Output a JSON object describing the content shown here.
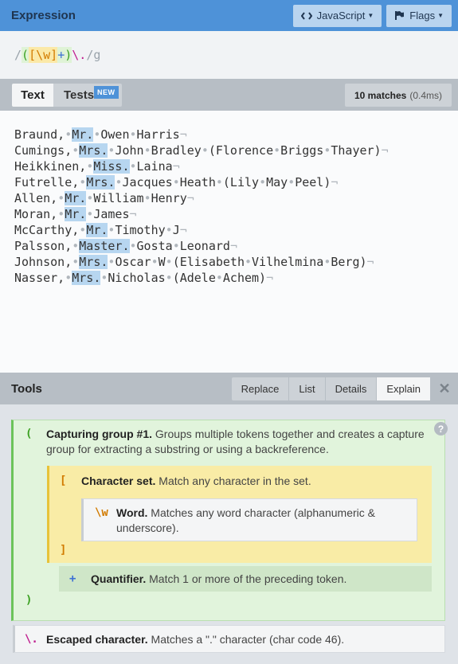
{
  "header": {
    "title": "Expression",
    "flavor_button": "JavaScript",
    "flags_button": "Flags"
  },
  "expression": {
    "open_slash": "/",
    "open_paren": "(",
    "open_bracket": "[",
    "word_token": "\\w",
    "close_bracket": "]",
    "plus": "+",
    "close_paren": ")",
    "escaped_dot": "\\.",
    "close_slash": "/",
    "flags": "g"
  },
  "text_panel": {
    "tab_text": "Text",
    "tab_tests": "Tests",
    "new_badge": "NEW",
    "match_count": "10 matches",
    "match_time": "(0.4ms)",
    "lines": [
      [
        "Braund,",
        " ",
        "Mr.",
        " ",
        "Owen",
        " ",
        "Harris"
      ],
      [
        "Cumings,",
        " ",
        "Mrs.",
        " ",
        "John",
        " ",
        "Bradley",
        " ",
        "(Florence",
        " ",
        "Briggs",
        " ",
        "Thayer)"
      ],
      [
        "Heikkinen,",
        " ",
        "Miss.",
        " ",
        "Laina"
      ],
      [
        "Futrelle,",
        " ",
        "Mrs.",
        " ",
        "Jacques",
        " ",
        "Heath",
        " ",
        "(Lily",
        " ",
        "May",
        " ",
        "Peel)"
      ],
      [
        "Allen,",
        " ",
        "Mr.",
        " ",
        "William",
        " ",
        "Henry"
      ],
      [
        "Moran,",
        " ",
        "Mr.",
        " ",
        "James"
      ],
      [
        "McCarthy,",
        " ",
        "Mr.",
        " ",
        "Timothy",
        " ",
        "J"
      ],
      [
        "Palsson,",
        " ",
        "Master.",
        " ",
        "Gosta",
        " ",
        "Leonard"
      ],
      [
        "Johnson,",
        " ",
        "Mrs.",
        " ",
        "Oscar",
        " ",
        "W",
        " ",
        "(Elisabeth",
        " ",
        "Vilhelmina",
        " ",
        "Berg)"
      ],
      [
        "Nasser,",
        " ",
        "Mrs.",
        " ",
        "Nicholas",
        " ",
        "(Adele",
        " ",
        "Achem)"
      ]
    ],
    "space_glyph": "•",
    "newline_glyph": "¬"
  },
  "tools": {
    "title": "Tools",
    "tabs": [
      "Replace",
      "List",
      "Details",
      "Explain"
    ],
    "active_tab": "Explain",
    "close_glyph": "✕"
  },
  "explain": {
    "group_open": "(",
    "group_close": ")",
    "group_title": "Capturing group #1.",
    "group_desc": "Groups multiple tokens together and creates a capture group for extracting a substring or using a backreference.",
    "set_open": "[",
    "set_close": "]",
    "set_title": "Character set.",
    "set_desc": "Match any character in the set.",
    "word_token": "\\w",
    "word_title": "Word.",
    "word_desc": "Matches any word character (alphanumeric & underscore).",
    "quant_token": "+",
    "quant_title": "Quantifier.",
    "quant_desc": "Match 1 or more of the preceding token.",
    "esc_token": "\\.",
    "esc_title": "Escaped character.",
    "esc_desc": "Matches a \".\" character (char code 46).",
    "help_glyph": "?"
  },
  "colors": {
    "header_bg": "#4e92d8",
    "match_highlight": "#b7d6f0",
    "group_bg": "#e1f4dc",
    "set_bg": "#f9eca6"
  }
}
